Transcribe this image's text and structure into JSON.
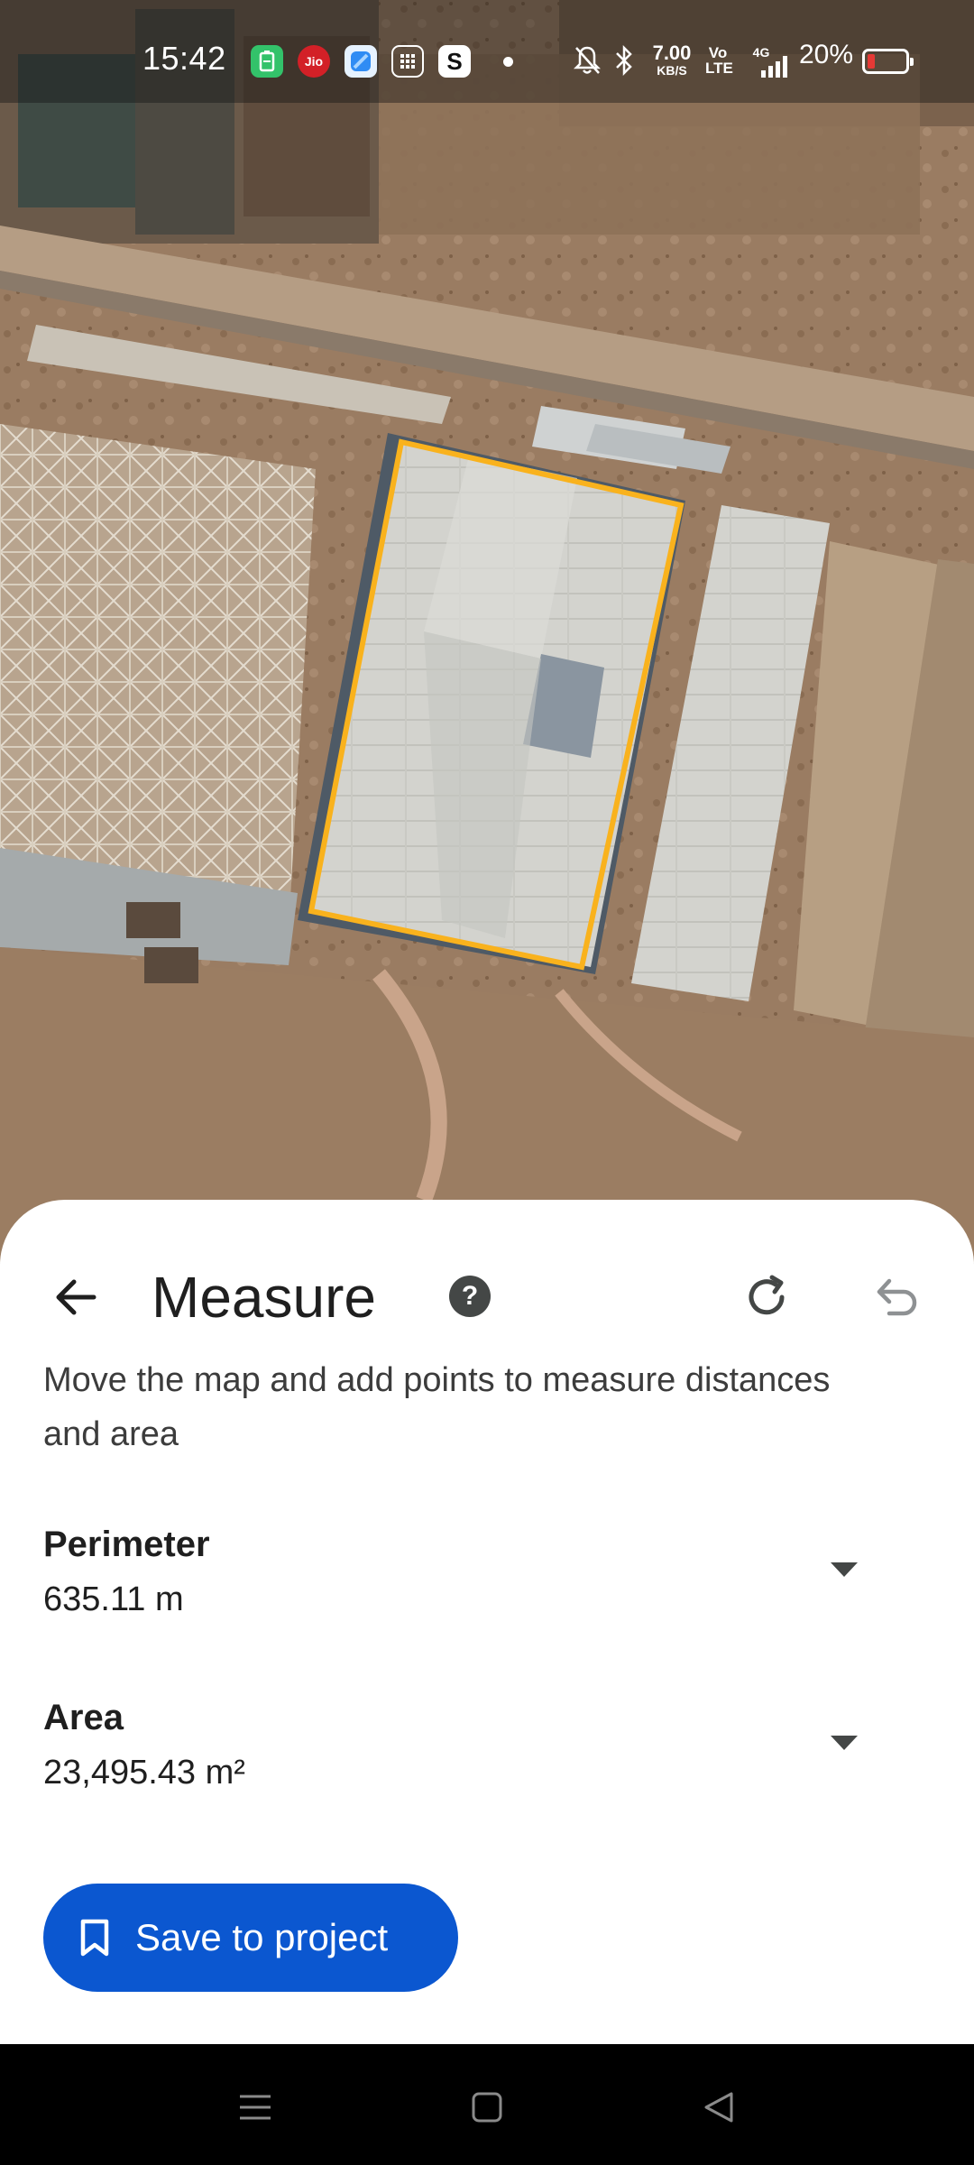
{
  "status_bar": {
    "time": "15:42",
    "carrier_badge": "Jio",
    "data_speed_value": "7.00",
    "data_speed_unit": "KB/S",
    "volte_top": "Vo",
    "volte_bottom": "LTE",
    "network": "4G",
    "battery_percent": "20%",
    "battery_level": 0.2,
    "icons": [
      "battery-saver-app-icon",
      "jio-app-icon",
      "blue-app-icon",
      "calculator-app-icon",
      "s-app-icon",
      "notification-dot",
      "mute-bell-icon",
      "bluetooth-icon",
      "volte-icon",
      "signal-icon",
      "battery-icon"
    ]
  },
  "map": {
    "type": "satellite",
    "measure_polygon_color": "#f9b21d"
  },
  "sheet": {
    "title": "Measure",
    "back_icon": "arrow-back-icon",
    "help_icon": "help-icon",
    "redo_icon": "redo-icon",
    "undo_icon": "undo-icon",
    "instructions": "Move the map and add points to measure distances and area",
    "perimeter": {
      "label": "Perimeter",
      "value": "635.11 m"
    },
    "area": {
      "label": "Area",
      "value": "23,495.43 m²"
    },
    "save_button": {
      "label": "Save to project",
      "icon": "bookmark-icon",
      "color": "#0b57d0"
    }
  },
  "nav_bar": {
    "items": [
      "menu-icon",
      "home-square-icon",
      "back-triangle-icon"
    ]
  }
}
